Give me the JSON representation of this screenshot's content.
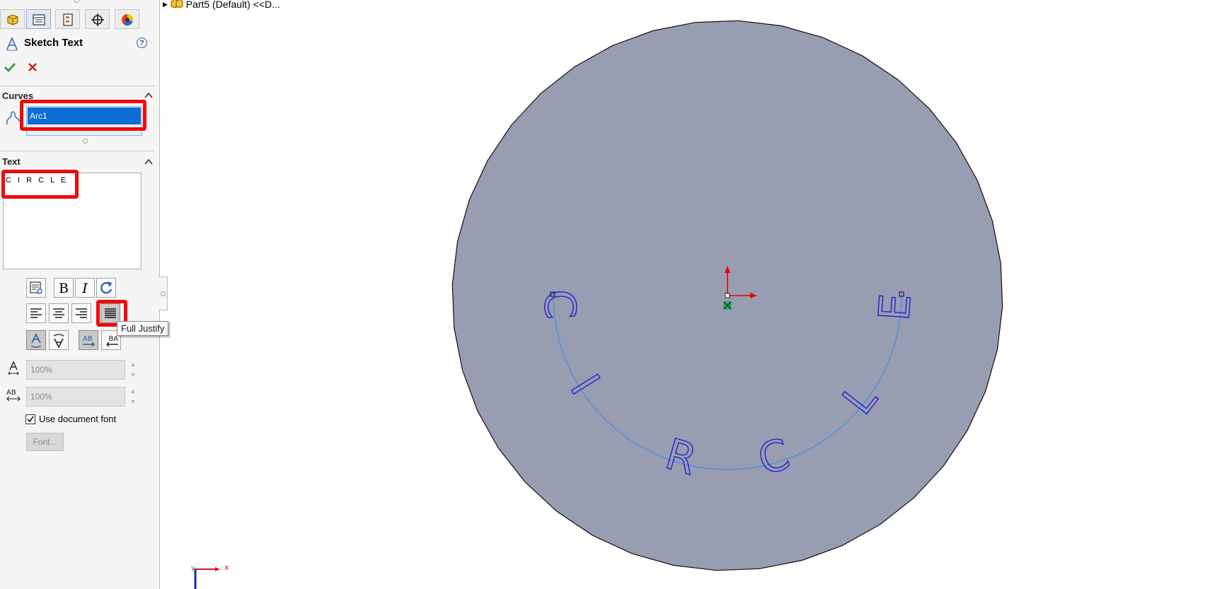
{
  "panel": {
    "title": "Sketch Text",
    "help": "?",
    "curves": {
      "label": "Curves",
      "selected": "Arc1"
    },
    "text": {
      "label": "Text",
      "value": "CIRCLE",
      "display": "C I R C L E"
    },
    "format_buttons": {
      "bold": "B",
      "italic": "I"
    },
    "width_factor": "100%",
    "spacing": "100%",
    "use_document_font": {
      "label": "Use document font",
      "checked": true
    },
    "font_button": "Font...",
    "tooltip": "Full Justify"
  },
  "tree": {
    "label": "Part5 (Default) <<D..."
  },
  "sketch": {
    "text": "CIRCLE",
    "letters": [
      "C",
      "I",
      "R",
      "C",
      "L",
      "E"
    ],
    "triad": {
      "x": "x",
      "y": "y"
    }
  },
  "colors": {
    "face": "#989db2",
    "sketch_text": "#2222cc",
    "arc": "#4a90e2",
    "highlight": "#ee0b0b",
    "selection": "#0a6ed4"
  }
}
